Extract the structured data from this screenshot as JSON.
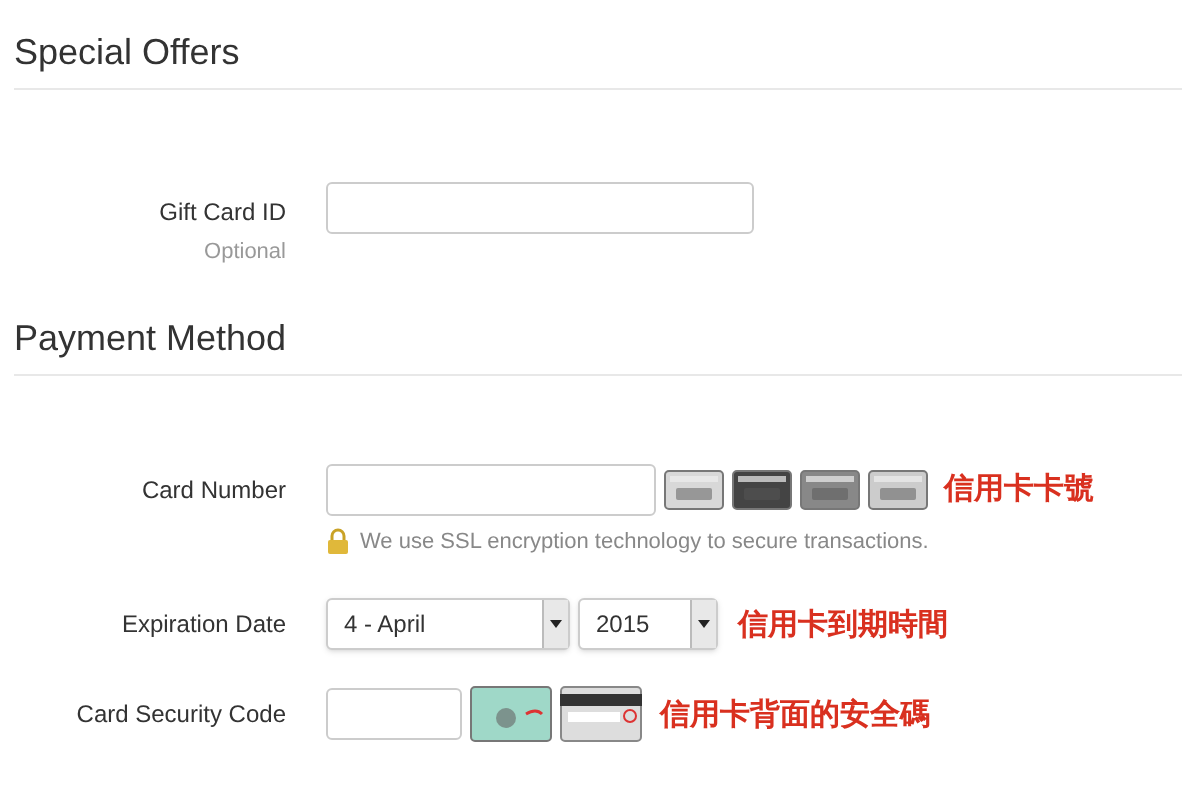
{
  "sections": [
    {
      "title": "Special Offers",
      "rows": [
        {
          "kind": "gift",
          "label": "Gift Card ID",
          "hint": "Optional"
        }
      ]
    },
    {
      "title": "Payment Method",
      "rows": [
        {
          "kind": "card",
          "label": "Card Number",
          "note": "信用卡卡號",
          "security": "We use SSL encryption technology to secure transactions."
        },
        {
          "kind": "expiry",
          "label": "Expiration Date",
          "month": "4 - April",
          "year": "2015",
          "note": "信用卡到期時間"
        },
        {
          "kind": "cvc",
          "label": "Card Security Code",
          "note": "信用卡背面的安全碼"
        }
      ]
    }
  ]
}
